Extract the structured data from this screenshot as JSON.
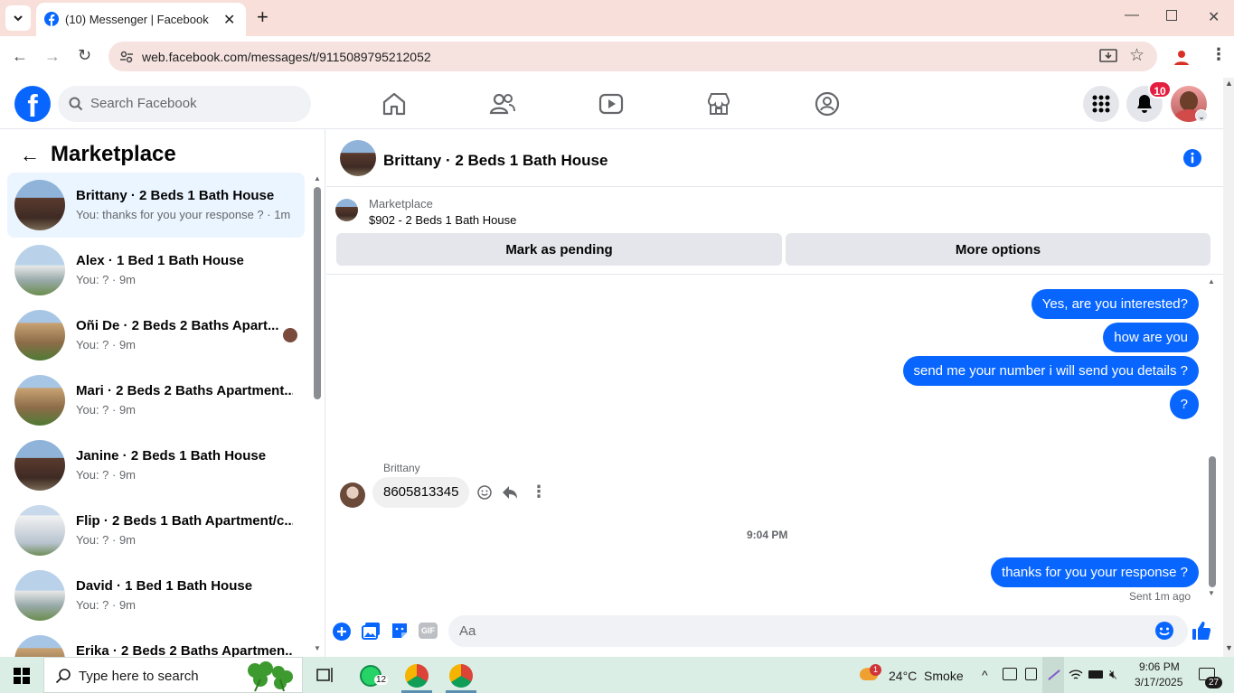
{
  "browser": {
    "tab_title": "(10) Messenger | Facebook",
    "url": "web.facebook.com/messages/t/9115089795212052"
  },
  "fb": {
    "search_placeholder": "Search Facebook",
    "notification_count": "10"
  },
  "left": {
    "title": "Marketplace",
    "conversations": [
      {
        "name": "Brittany · 2 Beds 1 Bath House",
        "sub": "You: thanks for you your response ? · 1m",
        "active": true
      },
      {
        "name": "Alex · 1 Bed 1 Bath House",
        "sub": "You: ? · 9m"
      },
      {
        "name": "Oñi De · 2 Beds 2 Baths Apart...",
        "sub": "You: ? · 9m"
      },
      {
        "name": "Mari · 2 Beds 2 Baths Apartment...",
        "sub": "You: ? · 9m"
      },
      {
        "name": "Janine · 2 Beds 1 Bath House",
        "sub": "You: ? · 9m"
      },
      {
        "name": "Flip · 2 Beds 1 Bath Apartment/c...",
        "sub": "You: ? · 9m"
      },
      {
        "name": "David · 1 Bed 1 Bath House",
        "sub": "You: ? · 9m"
      },
      {
        "name": "Erika · 2 Beds 2 Baths Apartmen...",
        "sub": ""
      }
    ]
  },
  "chat": {
    "title": "Brittany · 2 Beds 1 Bath House",
    "listing_label": "Marketplace",
    "listing_price": "$902 - 2 Beds 1 Bath House",
    "mark_pending": "Mark as pending",
    "more_options": "More options",
    "messages_out_top": [
      "Yes, are you interested?",
      "how are you",
      "send me your number i will send you details ?",
      "?"
    ],
    "sender_name": "Brittany",
    "incoming": "8605813345",
    "timestamp": "9:04 PM",
    "last_out": "thanks for you your response ?",
    "sent_status": "Sent 1m ago",
    "composer_placeholder": "Aa"
  },
  "taskbar": {
    "search_placeholder": "Type here to search",
    "whatsapp_badge": "12",
    "weather": "24°C  Smoke",
    "weather_badge": "1",
    "time": "9:06 PM",
    "date": "3/17/2025",
    "notif_count": "27"
  },
  "colors": {
    "fb_blue": "#0866ff",
    "tab_bg": "#f8dfd9",
    "taskbar": "#dbeee6"
  }
}
